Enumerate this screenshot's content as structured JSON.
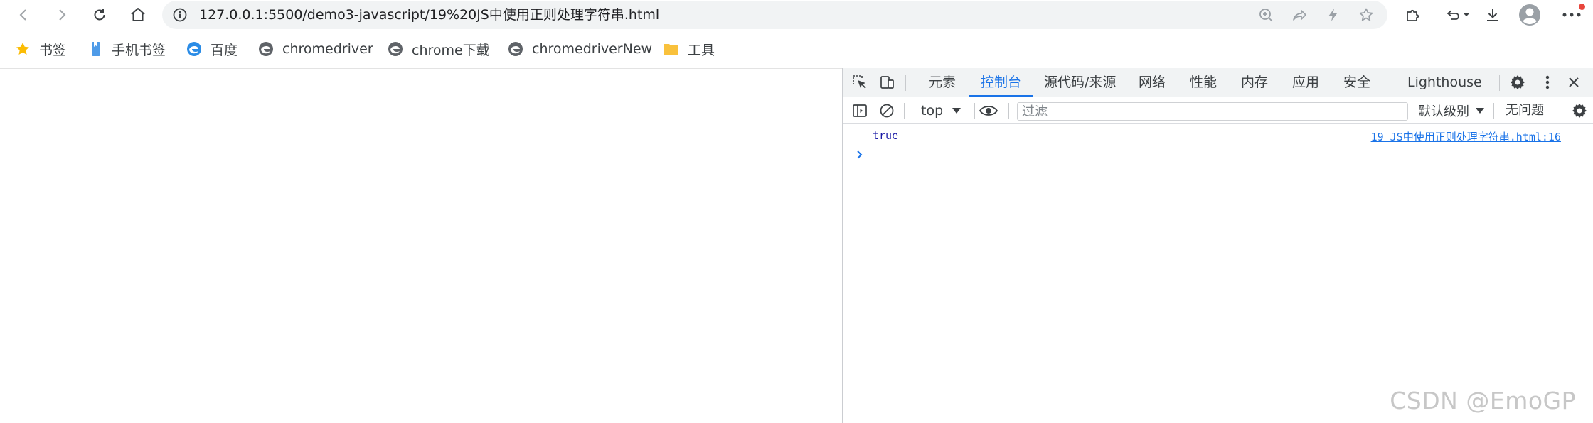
{
  "browser": {
    "url": "127.0.0.1:5500/demo3-javascript/19%20JS中使用正则处理字符串.html"
  },
  "bookmarks": [
    {
      "label": "书签",
      "icon": "star-icon"
    },
    {
      "label": "手机书签",
      "icon": "phone-bookmark-icon"
    },
    {
      "label": "百度",
      "icon": "edge-icon"
    },
    {
      "label": "chromedriver",
      "icon": "site-favicon-icon"
    },
    {
      "label": "chrome下载",
      "icon": "site-favicon-icon"
    },
    {
      "label": "chromedriverNew",
      "icon": "site-favicon-icon"
    },
    {
      "label": "工具",
      "icon": "folder-icon"
    }
  ],
  "devtools": {
    "tabs": [
      "元素",
      "控制台",
      "源代码/来源",
      "网络",
      "性能",
      "内存",
      "应用",
      "安全",
      "Lighthouse"
    ],
    "active_tab": "控制台",
    "context": "top",
    "filter_placeholder": "过滤",
    "level": "默认级别",
    "issues": "无问题",
    "console": {
      "log_message": "true",
      "log_source": "19 JS中使用正则处理字符串.html:16"
    }
  },
  "watermark": "CSDN @EmoGP",
  "colors": {
    "accent": "#1a73e8",
    "omnibox_bg": "#f1f3f4",
    "notification_dot": "#e8453c",
    "folder": "#f9c13c",
    "star": "#fbbc04"
  }
}
